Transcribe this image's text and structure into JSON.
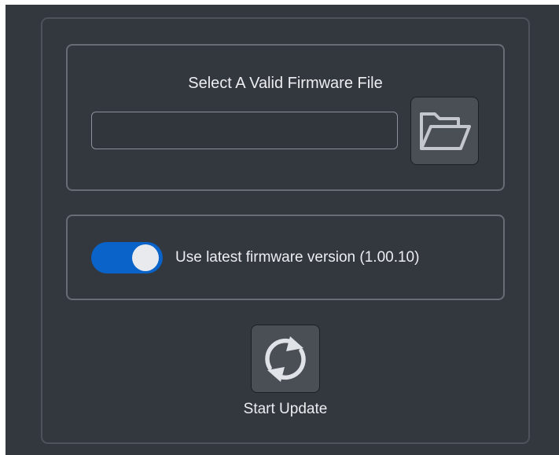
{
  "firmware_file": {
    "title": "Select A Valid Firmware File",
    "path_value": "",
    "browse_icon": "folder-open-icon"
  },
  "latest_version": {
    "enabled": true,
    "label": "Use latest firmware version (1.00.10)"
  },
  "update": {
    "label": "Start Update",
    "icon": "refresh-icon"
  },
  "colors": {
    "background": "#33373e",
    "panel_border": "#686d75",
    "toggle_on": "#0963c9",
    "text": "#eceef1"
  }
}
